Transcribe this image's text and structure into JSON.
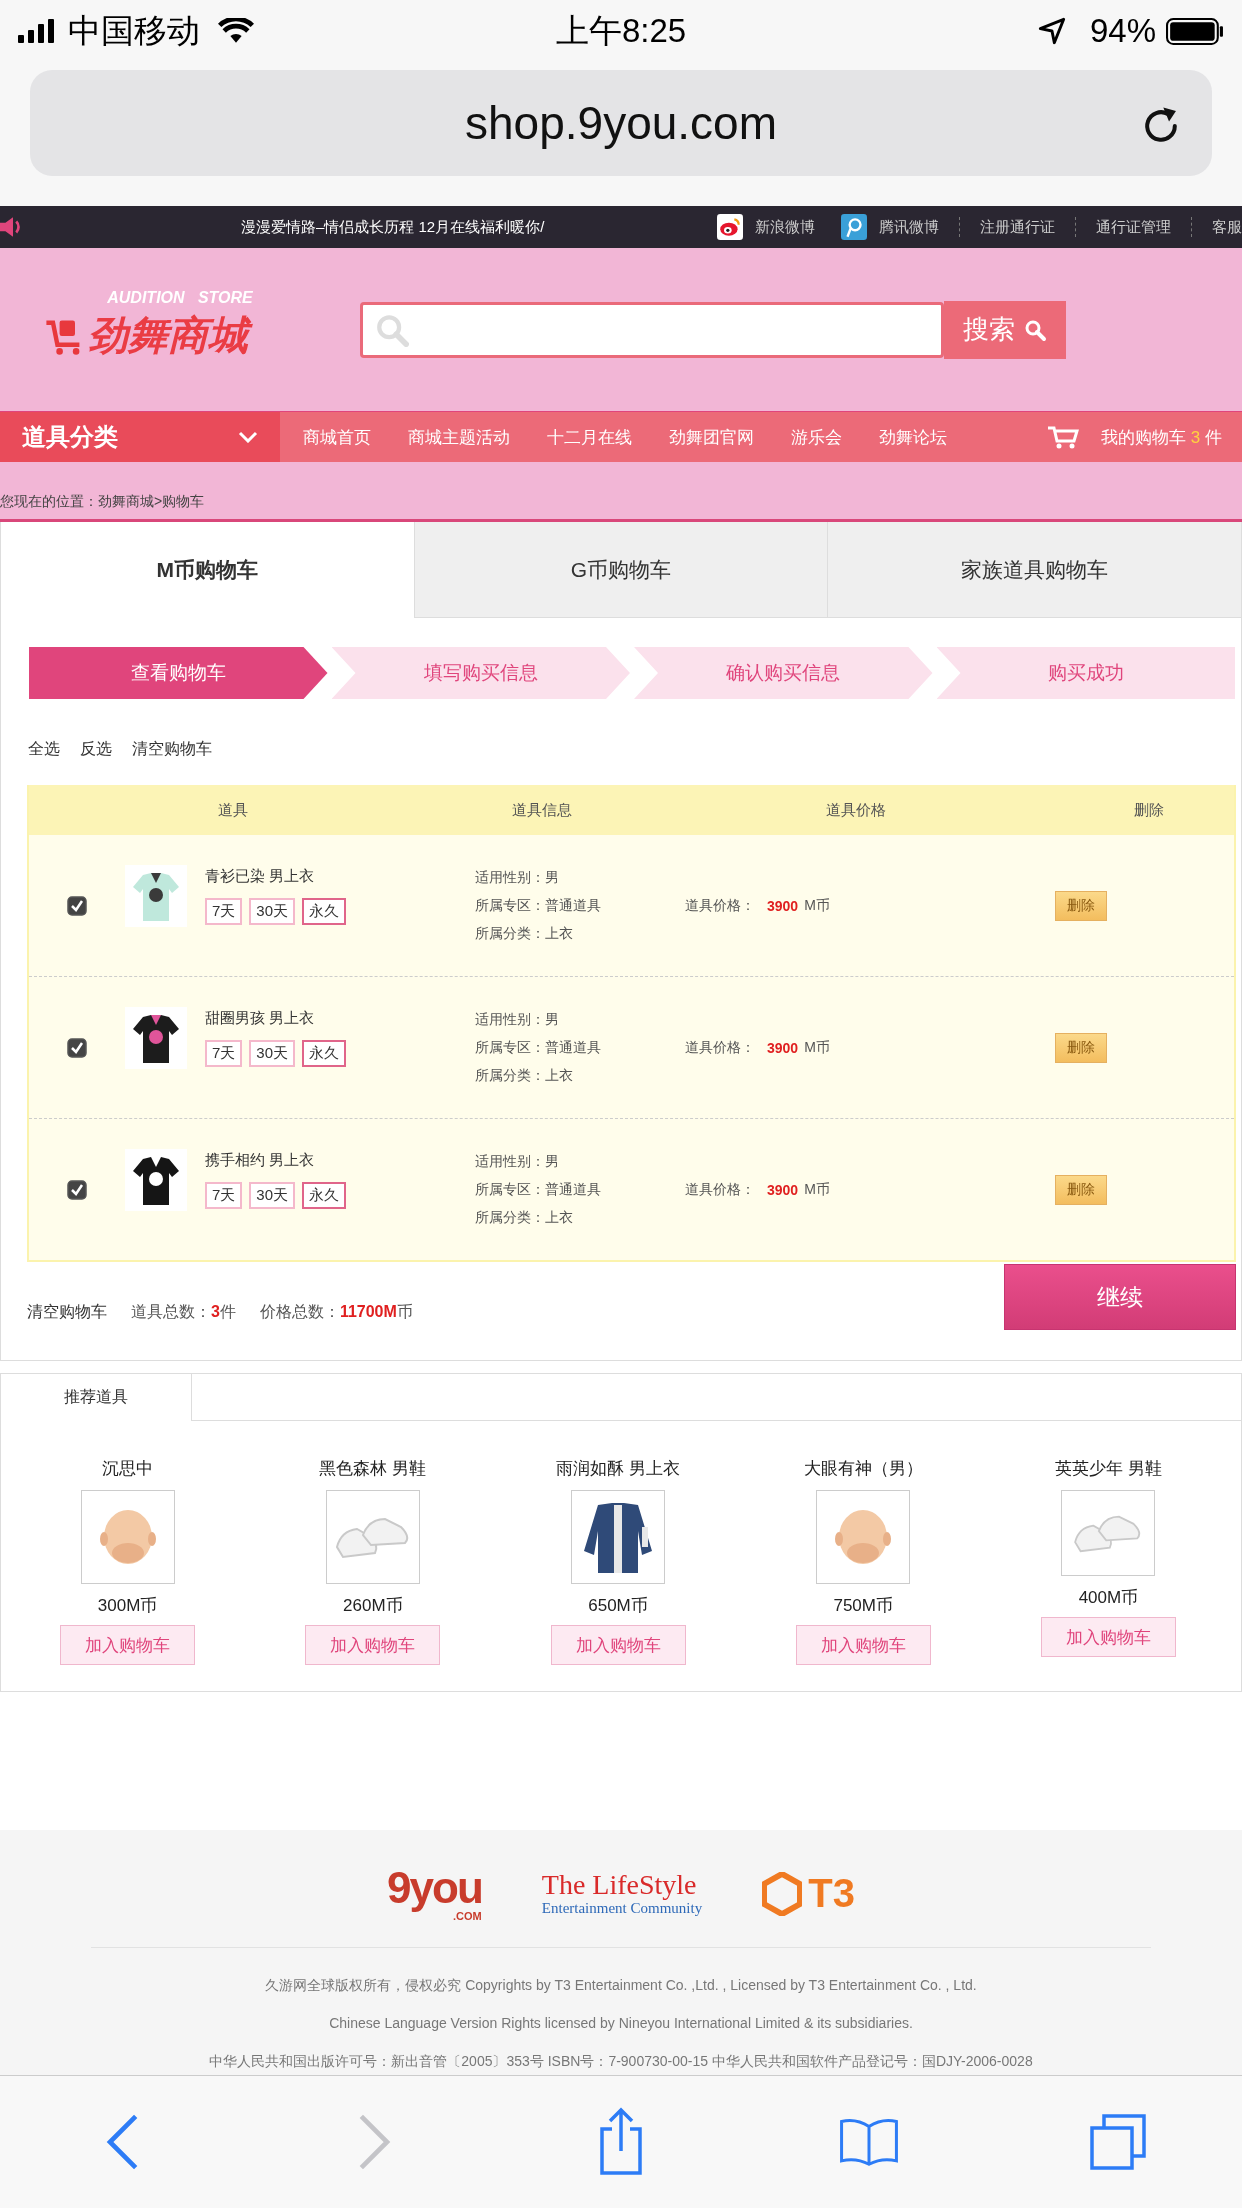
{
  "status_bar": {
    "carrier": "中国移动",
    "time": "上午8:25",
    "battery": "94%"
  },
  "browser": {
    "url": "shop.9you.com"
  },
  "top_bar": {
    "ticker": "漫漫爱情路–情侣成长历程  12月在线福利暖你/",
    "links": [
      {
        "label": "新浪微博",
        "kind": "weibo"
      },
      {
        "label": "腾讯微博",
        "kind": "tencent"
      },
      {
        "label": "注册通行证",
        "kind": "text"
      },
      {
        "label": "通行证管理",
        "kind": "text"
      },
      {
        "label": "客服",
        "kind": "text"
      }
    ]
  },
  "header": {
    "logo_subtitle": "AUDITION   STORE",
    "logo_title": "劲舞商城",
    "search_button": "搜索"
  },
  "nav": {
    "category": "道具分类",
    "items": [
      "商城首页",
      "商城主题活动",
      "十二月在线",
      "劲舞团官网",
      "游乐会",
      "劲舞论坛"
    ],
    "cart_label": "我的购物车",
    "cart_count": "3",
    "cart_unit": "件"
  },
  "breadcrumb": "您现在的位置：劲舞商城>购物车",
  "cart_tabs": [
    {
      "label": "M币购物车",
      "selected": true
    },
    {
      "label": "G币购物车",
      "selected": false
    },
    {
      "label": "家族道具购物车",
      "selected": false
    }
  ],
  "steps": [
    {
      "label": "查看购物车",
      "selected": true
    },
    {
      "label": "填写购买信息",
      "selected": false
    },
    {
      "label": "确认购买信息",
      "selected": false
    },
    {
      "label": "购买成功",
      "selected": false
    }
  ],
  "actions": [
    "全选",
    "反选",
    "清空购物车"
  ],
  "table": {
    "columns": [
      "道具",
      "道具信息",
      "道具价格",
      "删除"
    ],
    "rows": [
      {
        "checked": true,
        "name": "青衫已染 男上衣",
        "kind": "shirt",
        "durations": [
          {
            "label": "7天",
            "selected": false
          },
          {
            "label": "30天",
            "selected": false
          },
          {
            "label": "永久",
            "selected": true
          }
        ],
        "info": [
          "适用性别：男",
          "所属专区：普通道具",
          "所属分类：上衣"
        ],
        "price_label": "道具价格：",
        "price": "3900",
        "currency": "M币",
        "delete": "删除"
      },
      {
        "checked": true,
        "name": "甜圈男孩 男上衣",
        "kind": "vest",
        "durations": [
          {
            "label": "7天",
            "selected": false
          },
          {
            "label": "30天",
            "selected": false
          },
          {
            "label": "永久",
            "selected": true
          }
        ],
        "info": [
          "适用性别：男",
          "所属专区：普通道具",
          "所属分类：上衣"
        ],
        "price_label": "道具价格：",
        "price": "3900",
        "currency": "M币",
        "delete": "删除"
      },
      {
        "checked": true,
        "name": "携手相约 男上衣",
        "kind": "tee",
        "durations": [
          {
            "label": "7天",
            "selected": false
          },
          {
            "label": "30天",
            "selected": false
          },
          {
            "label": "永久",
            "selected": true
          }
        ],
        "info": [
          "适用性别：男",
          "所属专区：普通道具",
          "所属分类：上衣"
        ],
        "price_label": "道具价格：",
        "price": "3900",
        "currency": "M币",
        "delete": "删除"
      }
    ]
  },
  "totals": {
    "clear": "清空购物车",
    "count_label": "道具总数：",
    "count": "3",
    "count_unit": "件",
    "price_label": "价格总数：",
    "price": "11700M",
    "price_unit": "币",
    "continue": "继续"
  },
  "recommended": {
    "tab": "推荐道具",
    "items": [
      {
        "name": "沉思中",
        "kind": "face",
        "price": "300M币",
        "button": "加入购物车"
      },
      {
        "name": "黑色森林 男鞋",
        "kind": "shoes",
        "price": "260M币",
        "button": "加入购物车"
      },
      {
        "name": "雨润如酥 男上衣",
        "kind": "jacket",
        "price": "650M币",
        "button": "加入购物车"
      },
      {
        "name": "大眼有神（男）",
        "kind": "face",
        "price": "750M币",
        "button": "加入购物车"
      },
      {
        "name": "英英少年 男鞋",
        "kind": "shoes",
        "price": "400M币",
        "button": "加入购物车"
      }
    ]
  },
  "footer": {
    "logos": [
      {
        "kind": "nineyou",
        "text": "9you",
        "sub": ".COM"
      },
      {
        "kind": "lifestyle",
        "text": "The LifeStyle",
        "sub": "Entertainment Community"
      },
      {
        "kind": "t3",
        "text": "T3"
      }
    ],
    "lines": [
      "久游网全球版权所有，侵权必究 Copyrights by T3 Entertainment Co. ,Ltd. , Licensed by T3 Entertainment Co. , Ltd.",
      "Chinese Language Version Rights licensed by Nineyou International Limited & its subsidiaries.",
      "中华人民共和国出版许可号：新出音管〔2005〕353号 ISBN号：7-900730-00-15 中华人民共和国软件产品登记号：国DJY-2006-0028"
    ]
  }
}
